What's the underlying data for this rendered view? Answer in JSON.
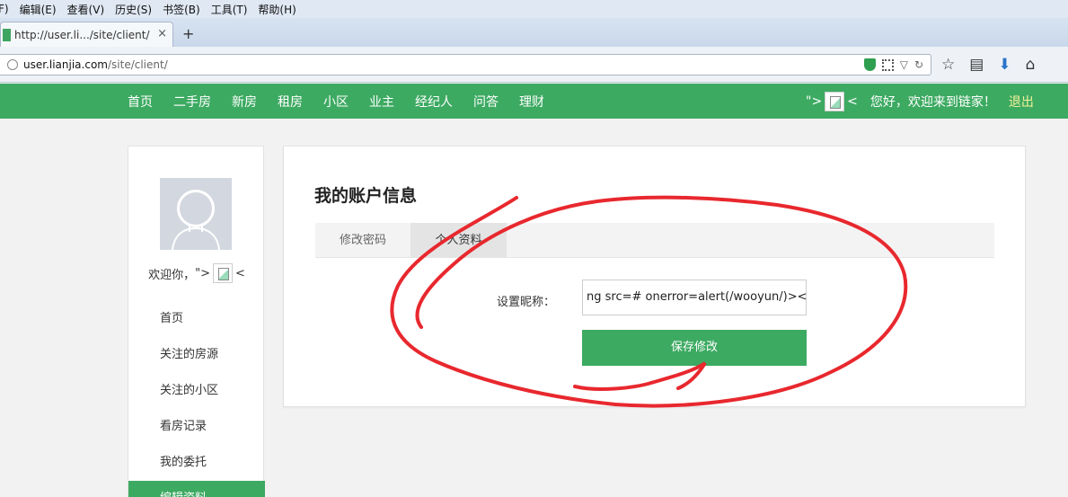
{
  "browser": {
    "menu": [
      "F)",
      "编辑(E)",
      "查看(V)",
      "历史(S)",
      "书签(B)",
      "工具(T)",
      "帮助(H)"
    ],
    "tab_title": "http://user.li.../site/client/",
    "url_host": "user.lianjia.com",
    "url_path": "/site/client/"
  },
  "site_nav": {
    "items": [
      "首页",
      "二手房",
      "新房",
      "租房",
      "小区",
      "业主",
      "经纪人",
      "问答",
      "理财"
    ],
    "xss_prefix": "\">",
    "xss_suffix": "<",
    "welcome": "您好，欢迎来到链家！",
    "logout": "退出"
  },
  "sidebar": {
    "greeting": "欢迎你，",
    "xss_prefix": "\">",
    "xss_suffix": "<",
    "items": [
      "首页",
      "关注的房源",
      "关注的小区",
      "看房记录",
      "我的委托",
      "编辑资料"
    ]
  },
  "main": {
    "title": "我的账户信息",
    "tabs": [
      "修改密码",
      "个人资料"
    ],
    "nickname_label": "设置昵称：",
    "nickname_value": "ng src=# onerror=alert(/wooyun/)><",
    "save_label": "保存修改"
  },
  "colors": {
    "brand_green": "#3daa62",
    "annotation_red": "#e8282e"
  }
}
